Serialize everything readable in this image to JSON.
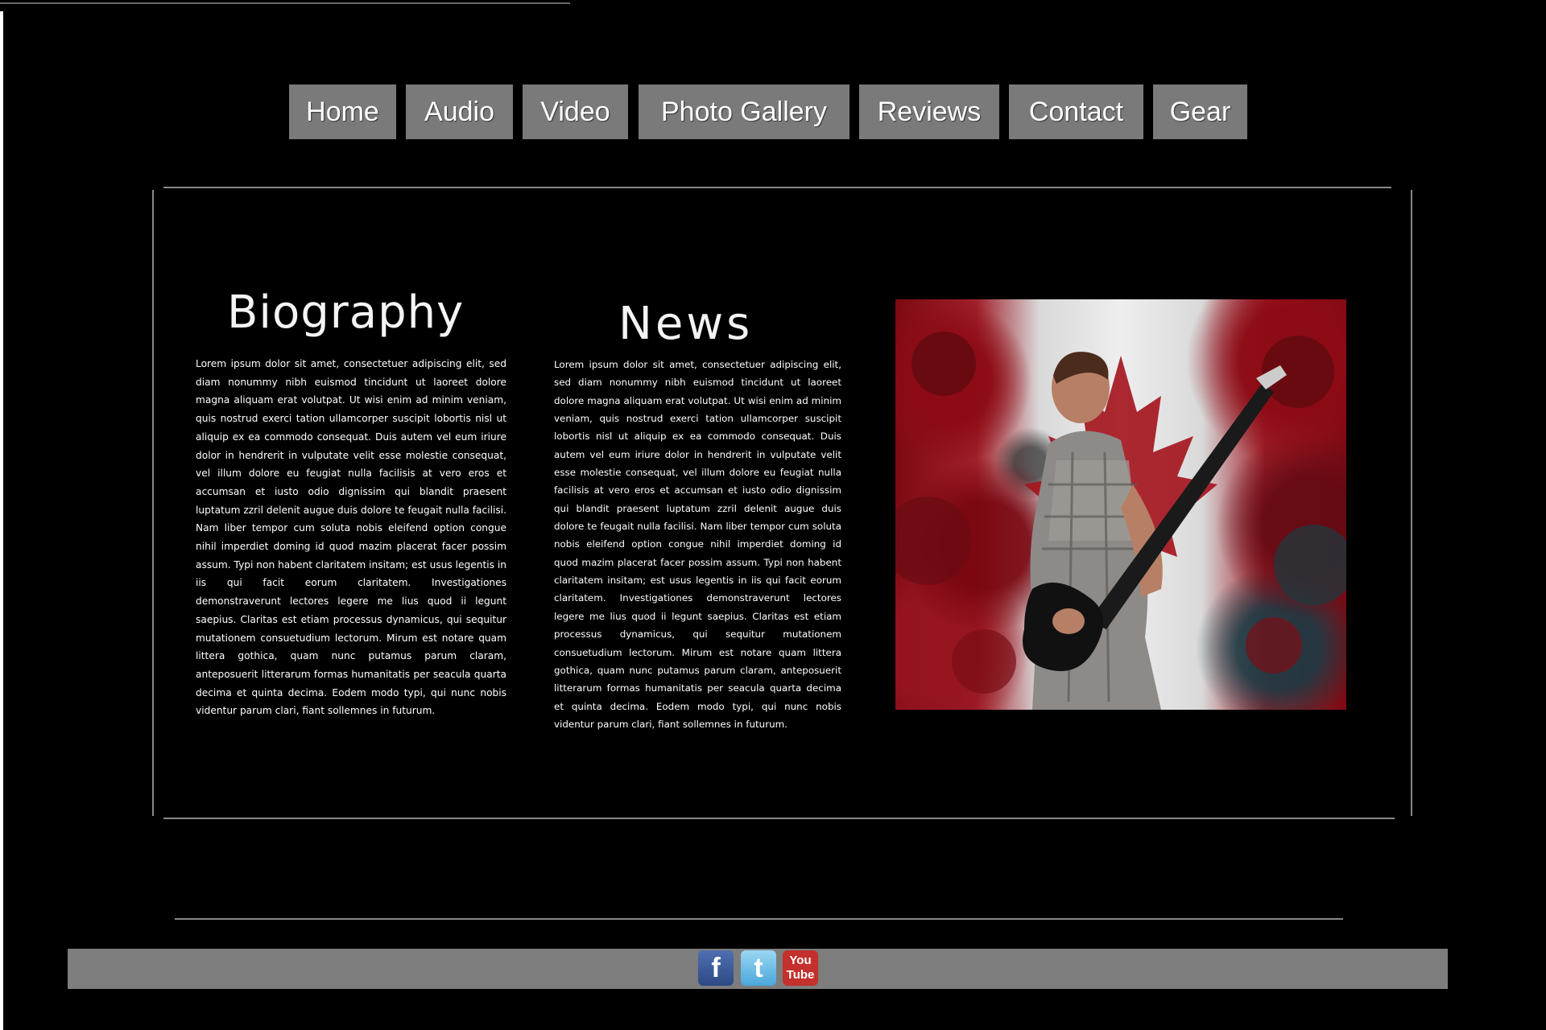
{
  "nav": {
    "items": [
      "Home",
      "Audio",
      "Video",
      "Photo Gallery",
      "Reviews",
      "Contact",
      "Gear"
    ]
  },
  "biography": {
    "heading": "Biography",
    "text": "Lorem ipsum dolor sit amet, consectetuer adipiscing elit, sed diam nonummy nibh euismod tincidunt ut laoreet dolore magna aliquam erat volutpat. Ut wisi enim ad minim veniam, quis nostrud exerci tation ullamcorper suscipit lobortis nisl ut aliquip ex ea commodo consequat. Duis autem vel eum iriure dolor in hendrerit in vulputate velit esse molestie consequat, vel illum dolore eu feugiat nulla facilisis at vero eros et accumsan et iusto odio dignissim qui blandit praesent luptatum zzril delenit augue duis dolore te feugait nulla facilisi. Nam liber tempor cum soluta nobis eleifend option congue nihil imperdiet doming id quod mazim placerat facer possim assum. Typi non habent claritatem insitam; est usus legentis in iis qui facit eorum claritatem. Investigationes demonstraverunt lectores legere me lius quod ii legunt saepius. Claritas est etiam processus dynamicus, qui sequitur mutationem consuetudium lectorum. Mirum est notare quam littera gothica, quam nunc putamus parum claram, anteposuerit litterarum formas humanitatis per seacula quarta decima et quinta decima. Eodem modo typi, qui nunc nobis videntur parum clari, fiant sollemnes in futurum."
  },
  "news": {
    "heading": "News",
    "text": "Lorem ipsum dolor sit amet, consectetuer adipiscing elit, sed diam nonummy nibh euismod tincidunt ut laoreet dolore magna aliquam erat volutpat. Ut wisi enim ad minim veniam, quis nostrud exerci tation ullamcorper suscipit lobortis nisl ut aliquip ex ea commodo consequat. Duis autem vel eum iriure dolor in hendrerit in vulputate velit esse molestie consequat, vel illum dolore eu feugiat nulla facilisis at vero eros et accumsan et iusto odio dignissim qui blandit praesent luptatum zzril delenit augue duis dolore te feugait nulla facilisi. Nam liber tempor cum soluta nobis eleifend option congue nihil imperdiet doming id quod mazim placerat facer possim assum. Typi non habent claritatem insitam; est usus legentis in iis qui facit eorum claritatem. Investigationes demonstraverunt lectores legere me lius quod ii legunt saepius. Claritas est etiam processus dynamicus, qui sequitur mutationem consuetudium lectorum. Mirum est notare quam littera gothica, quam nunc putamus parum claram, anteposuerit litterarum formas humanitatis per seacula quarta decima et quinta decima. Eodem modo typi, qui nunc nobis videntur parum clari, fiant sollemnes in futurum."
  },
  "hero": {
    "icon": "guitarist-canada-flag-photo"
  },
  "footer": {
    "social": [
      {
        "icon": "facebook-icon",
        "glyph": "f",
        "color": "#3b5998"
      },
      {
        "icon": "twitter-icon",
        "glyph": "t",
        "color": "#5fb8e6"
      },
      {
        "icon": "youtube-icon",
        "glyph_top": "You",
        "glyph_bottom": "Tube",
        "color": "#c4302b"
      }
    ]
  },
  "colors": {
    "background": "#000000",
    "nav_button": "#7a7a7a",
    "footer_bar": "#7d7d7d",
    "divider": "#888888"
  }
}
